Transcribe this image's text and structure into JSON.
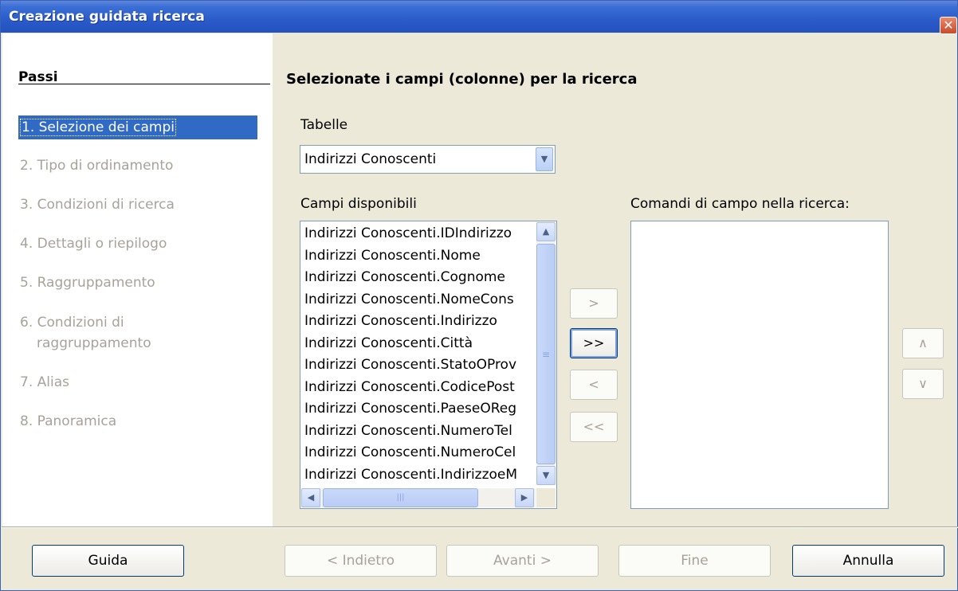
{
  "window": {
    "title": "Creazione guidata ricerca",
    "close_glyph": "✕"
  },
  "steps": {
    "header": "Passi",
    "items": [
      {
        "label": "1. Selezione dei campi",
        "active": true
      },
      {
        "label": "2. Tipo di ordinamento",
        "active": false
      },
      {
        "label": "3. Condizioni di ricerca",
        "active": false
      },
      {
        "label": "4. Dettagli o riepilogo",
        "active": false
      },
      {
        "label": "5. Raggruppamento",
        "active": false
      },
      {
        "label": "6. Condizioni di",
        "label2": "raggruppamento",
        "active": false
      },
      {
        "label": "7. Alias",
        "active": false
      },
      {
        "label": "8. Panoramica",
        "active": false
      }
    ]
  },
  "main": {
    "heading": "Selezionate i campi (colonne) per la ricerca",
    "tables_label": "Tabelle",
    "tables_value": "Indirizzi Conoscenti",
    "available_label": "Campi disponibili",
    "available_fields": [
      "Indirizzi Conoscenti.IDIndirizzo",
      "Indirizzi Conoscenti.Nome",
      "Indirizzi Conoscenti.Cognome",
      "Indirizzi Conoscenti.NomeCons",
      "Indirizzi Conoscenti.Indirizzo",
      "Indirizzi Conoscenti.Città",
      "Indirizzi Conoscenti.StatoOProv",
      "Indirizzi Conoscenti.CodicePost",
      "Indirizzi Conoscenti.PaeseOReg",
      "Indirizzi Conoscenti.NumeroTel",
      "Indirizzi Conoscenti.NumeroCel",
      "Indirizzi Conoscenti.IndirizzoeM"
    ],
    "selected_label": "Comandi di campo nella ricerca:",
    "selected_fields": []
  },
  "transfer_buttons": {
    "add_one": ">",
    "add_all": ">>",
    "remove_one": "<",
    "remove_all": "<<"
  },
  "order_buttons": {
    "up": "∧",
    "down": "∨"
  },
  "footer": {
    "help": "Guida",
    "back": "< Indietro",
    "next": "Avanti >",
    "finish": "Fine",
    "cancel": "Annulla"
  },
  "icons": {
    "combo_arrow": "chevron-down-icon",
    "scroll_up": "chevron-up-icon",
    "scroll_down": "chevron-down-icon",
    "scroll_left": "chevron-left-icon",
    "scroll_right": "chevron-right-icon"
  },
  "colors": {
    "title_bar": "#2a5bc9",
    "selection": "#316ac5",
    "dialog_bg": "#ece9d8",
    "disabled_text": "#a7a39a"
  }
}
